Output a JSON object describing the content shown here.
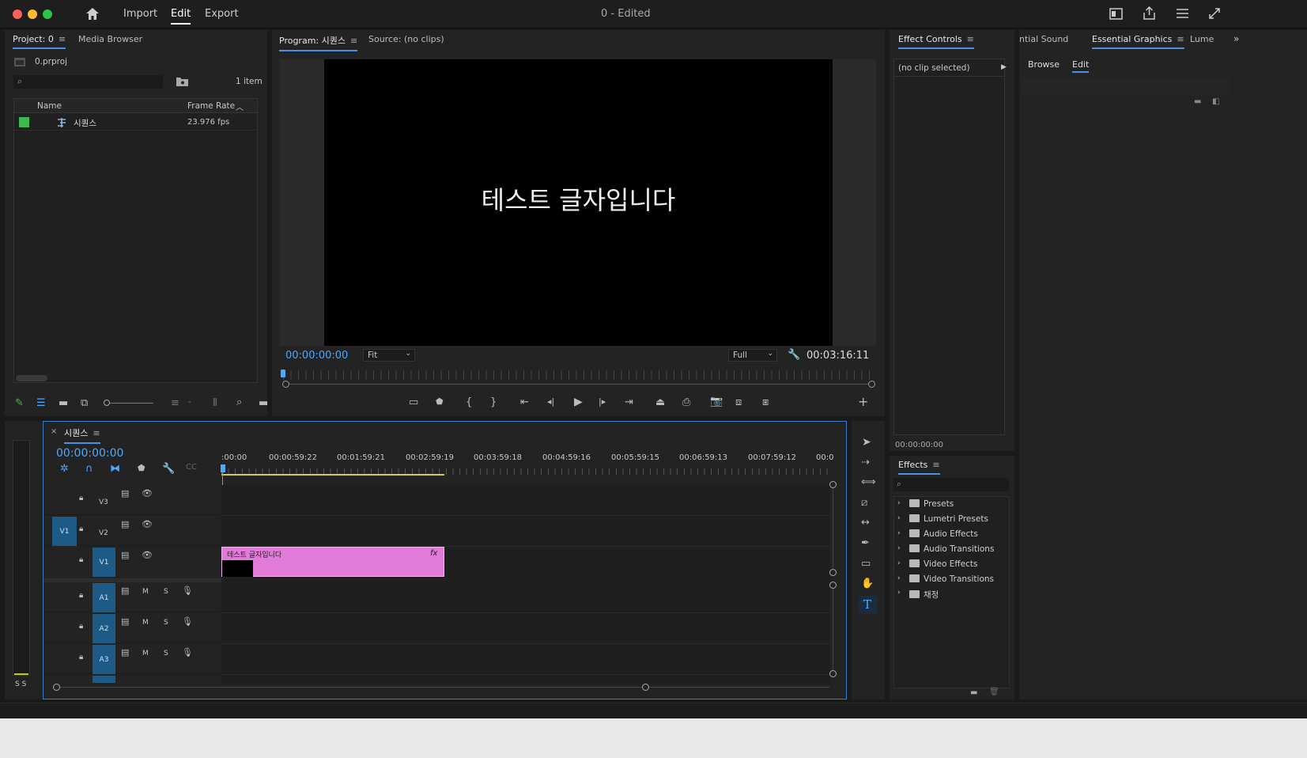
{
  "menu": {
    "items": [
      "Import",
      "Edit",
      "Export"
    ],
    "active": "Edit",
    "title": "0 - Edited"
  },
  "project": {
    "tab": "Project: 0",
    "tab2": "Media Browser",
    "file": "0.prproj",
    "item_count": "1 item",
    "col_name": "Name",
    "col_fps": "Frame Rate",
    "row_name": "시퀀스",
    "row_fps": "23.976 fps",
    "swatch": "#3dba4f"
  },
  "program": {
    "tab": "Program: 시퀀스",
    "tab2": "Source: (no clips)",
    "overlay_text": "테스트 글자입니다",
    "timecode": "00:00:00:00",
    "fit": "Fit",
    "quality": "Full",
    "duration": "00:03:16:11"
  },
  "effect_controls": {
    "tab": "Effect Controls",
    "noclip": "(no clip selected)",
    "timecode": "00:00:00:00"
  },
  "eg": {
    "tab_prev": "ntial Sound",
    "tab": "Essential Graphics",
    "tab_next": "Lume",
    "browse": "Browse",
    "edit": "Edit"
  },
  "timeline": {
    "tab": "시퀀스",
    "timecode": "00:00:00:00",
    "ruler": [
      ":00:00",
      "00:00:59:22",
      "00:01:59:21",
      "00:02:59:19",
      "00:03:59:18",
      "00:04:59:16",
      "00:05:59:15",
      "00:06:59:13",
      "00:07:59:12",
      "00:0"
    ],
    "tracks": [
      {
        "id": "V3"
      },
      {
        "id": "V2"
      },
      {
        "id": "V1"
      },
      {
        "id": "A1"
      },
      {
        "id": "A2"
      },
      {
        "id": "A3"
      }
    ],
    "src_patch": "V1",
    "clip_label": "테스트 글자입니다",
    "clip_fx": "fx",
    "clip_color": "#e17ad8",
    "mute": "M",
    "solo": "S",
    "meter": "S S"
  },
  "effects": {
    "tab": "Effects",
    "items": [
      "Presets",
      "Lumetri Presets",
      "Audio Effects",
      "Audio Transitions",
      "Video Effects",
      "Video Transitions",
      "채정"
    ]
  }
}
